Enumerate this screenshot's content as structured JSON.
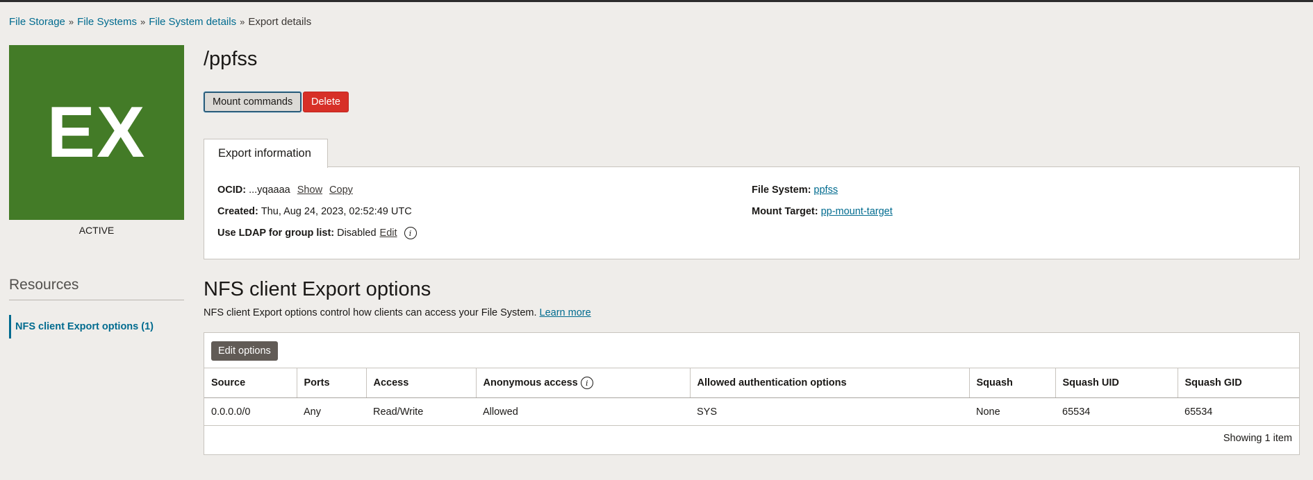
{
  "breadcrumb": {
    "items": [
      "File Storage",
      "File Systems",
      "File System details"
    ],
    "current": "Export details",
    "separator": "»"
  },
  "avatar": {
    "text": "EX",
    "color": "#437b27"
  },
  "status": "ACTIVE",
  "resources": {
    "title": "Resources",
    "items": [
      {
        "label": "NFS client Export options (1)"
      }
    ]
  },
  "page_title": "/ppfss",
  "actions": {
    "mount_label": "Mount commands",
    "delete_label": "Delete"
  },
  "tab": {
    "label": "Export information"
  },
  "info": {
    "ocid_label": "OCID:",
    "ocid_value": "...yqaaaa",
    "show_label": "Show",
    "copy_label": "Copy",
    "created_label": "Created:",
    "created_value": "Thu, Aug 24, 2023, 02:52:49 UTC",
    "ldap_label": "Use LDAP for group list:",
    "ldap_value": "Disabled",
    "edit_label": "Edit",
    "filesystem_label": "File System:",
    "filesystem_value": "ppfss",
    "mount_target_label": "Mount Target:",
    "mount_target_value": "pp-mount-target"
  },
  "nfs": {
    "title": "NFS client Export options",
    "description": "NFS client Export options control how clients can access your File System.",
    "learn_more": "Learn more",
    "edit_button": "Edit options",
    "columns": [
      "Source",
      "Ports",
      "Access",
      "Anonymous access",
      "Allowed authentication options",
      "Squash",
      "Squash UID",
      "Squash GID"
    ],
    "rows": [
      [
        "0.0.0.0/0",
        "Any",
        "Read/Write",
        "Allowed",
        "SYS",
        "None",
        "65534",
        "65534"
      ]
    ],
    "footer": "Showing 1 item"
  },
  "icons": {
    "info": "info-icon",
    "chevron": "double-chevron-right-icon"
  },
  "colors": {
    "link": "#006b8f",
    "delete": "#d73027",
    "avatar": "#437b27"
  }
}
